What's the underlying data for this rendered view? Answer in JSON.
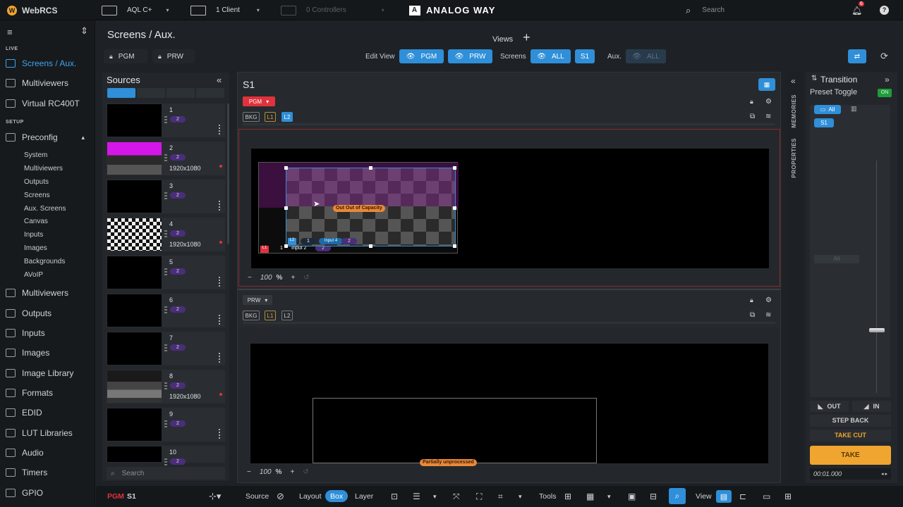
{
  "topbar": {
    "app_name": "WebRCS",
    "device": "AQL C+",
    "clients": "1 Client",
    "controllers": "0 Controllers",
    "brand": "ANALOG WAY",
    "search_placeholder": "Search",
    "notifications_count": "6",
    "help": "?"
  },
  "sidebar": {
    "sections": {
      "live": "LIVE",
      "setup": "SETUP"
    },
    "live_items": [
      {
        "label": "Screens / Aux.",
        "icon": "screens-icon"
      },
      {
        "label": "Multiviewers",
        "icon": "multiviewer-icon"
      },
      {
        "label": "Virtual RC400T",
        "icon": "remote-icon"
      }
    ],
    "preconfig": {
      "label": "Preconfig",
      "icon": "preconfig-icon",
      "caret": "▴"
    },
    "preconfig_items": [
      "System",
      "Multiviewers",
      "Outputs",
      "Screens",
      "Aux. Screens",
      "Canvas",
      "Inputs",
      "Images",
      "Backgrounds",
      "AVoIP"
    ],
    "setup_items": [
      {
        "label": "Multiviewers",
        "icon": "multiviewer-icon"
      },
      {
        "label": "Outputs",
        "icon": "outputs-icon"
      },
      {
        "label": "Inputs",
        "icon": "inputs-icon"
      },
      {
        "label": "Images",
        "icon": "images-icon"
      },
      {
        "label": "Image Library",
        "icon": "image-library-icon"
      },
      {
        "label": "Formats",
        "icon": "formats-icon"
      },
      {
        "label": "EDID",
        "icon": "edid-icon"
      },
      {
        "label": "LUT Libraries",
        "icon": "lut-icon"
      },
      {
        "label": "Audio",
        "icon": "audio-icon"
      },
      {
        "label": "Timers",
        "icon": "timers-icon"
      },
      {
        "label": "GPIO",
        "icon": "gpio-icon"
      }
    ]
  },
  "header": {
    "title": "Screens / Aux.",
    "views_label": "Views",
    "pgm_lock": "PGM",
    "prw_lock": "PRW",
    "edit_view_label": "Edit View",
    "edit_pgm": "PGM",
    "edit_prw": "PRW",
    "screens_label": "Screens",
    "screens_all": "ALL",
    "screens_s1": "S1",
    "aux_label": "Aux.",
    "aux_all": "ALL"
  },
  "sources": {
    "title": "Sources",
    "collapse": "«",
    "search_placeholder": "Search",
    "items": [
      {
        "num": "1",
        "pill": "2",
        "res": "",
        "thumb": "black"
      },
      {
        "num": "2",
        "pill": "2",
        "res": "1920x1080",
        "thumb": "magenta"
      },
      {
        "num": "3",
        "pill": "2",
        "res": "",
        "thumb": "black"
      },
      {
        "num": "4",
        "pill": "2",
        "res": "1920x1080",
        "thumb": "checker"
      },
      {
        "num": "5",
        "pill": "2",
        "res": "",
        "thumb": "black"
      },
      {
        "num": "6",
        "pill": "2",
        "res": "",
        "thumb": "black"
      },
      {
        "num": "7",
        "pill": "2",
        "res": "",
        "thumb": "black"
      },
      {
        "num": "8",
        "pill": "2",
        "res": "1920x1080",
        "thumb": "gray"
      },
      {
        "num": "9",
        "pill": "2",
        "res": "",
        "thumb": "black"
      },
      {
        "num": "10",
        "pill": "2",
        "res": "",
        "thumb": "black"
      }
    ]
  },
  "screen": {
    "name": "S1",
    "pgm": {
      "dropdown": "PGM",
      "layers": [
        "BKG",
        "L1",
        "L2"
      ],
      "zoom": "100",
      "zoom_unit": "%",
      "warning": "Out of Capacity",
      "warning_short": "Out",
      "layer2_tag": "L2",
      "layer2_num": "1",
      "layer2_input": "Input 4",
      "layer2_pill": "2",
      "layer1_tag": "L1",
      "layer1_num": "1",
      "layer1_input": "Input 2",
      "layer1_pill": "2"
    },
    "prw": {
      "dropdown": "PRW",
      "layers": [
        "BKG",
        "L1",
        "L2"
      ],
      "zoom": "100",
      "zoom_unit": "%",
      "warning": "Partially unprocessed"
    }
  },
  "right_strip": {
    "memories": "MEMORIES",
    "properties": "PROPERTIES"
  },
  "transition": {
    "title": "Transition",
    "preset_toggle": "Preset Toggle",
    "toggle_state": "ON",
    "all": "All",
    "s1": "S1",
    "all_dim": "All",
    "out": "OUT",
    "in": "IN",
    "step_back": "STEP BACK",
    "take_cut": "TAKE CUT",
    "take": "TAKE",
    "time": "00:01.000"
  },
  "footer": {
    "pgm": "PGM",
    "screen": "S1",
    "source": "Source",
    "layout": "Layout",
    "box": "Box",
    "layer": "Layer",
    "tools": "Tools",
    "view": "View"
  },
  "colors": {
    "accent": "#2f8fd8",
    "pgm_red": "#e0323c",
    "take_orange": "#f0a530",
    "layer_purple": "#4a2e7a"
  }
}
